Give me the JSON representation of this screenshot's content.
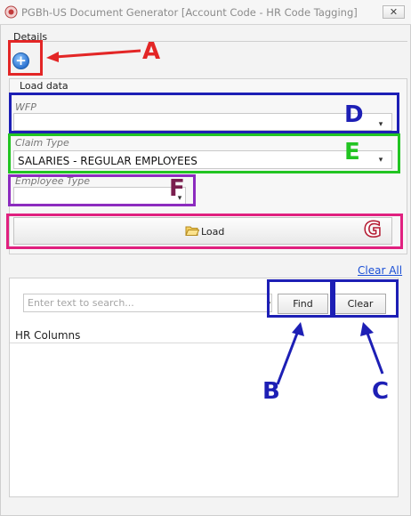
{
  "window": {
    "title": "PGBh-US Document Generator [Account Code - HR Code Tagging]",
    "close_glyph": "✕"
  },
  "tab": {
    "label": "Details"
  },
  "add_button": {
    "glyph": "+"
  },
  "load_group": {
    "title": "Load data",
    "wfp": {
      "label": "WFP",
      "value": ""
    },
    "claim_type": {
      "label": "Claim Type",
      "value": "SALARIES - REGULAR EMPLOYEES"
    },
    "employee_type": {
      "label": "Employee Type",
      "value": ""
    },
    "load_button": {
      "label": "Load",
      "icon": "folder-open-icon"
    }
  },
  "clear_all": "Clear All",
  "search": {
    "placeholder": "Enter text to search...",
    "find_label": "Find",
    "clear_label": "Clear"
  },
  "hr_columns": {
    "title": "HR Columns"
  },
  "annotations": {
    "A": "A",
    "B": "B",
    "C": "C",
    "D": "D",
    "E": "E",
    "F": "F",
    "G": "G",
    "colors": {
      "red": "#e32626",
      "blue": "#1d1fb5",
      "green": "#22c422",
      "purple": "#8c2bbf",
      "pink": "#e0207f",
      "pink_letter": "#b3182f"
    }
  }
}
